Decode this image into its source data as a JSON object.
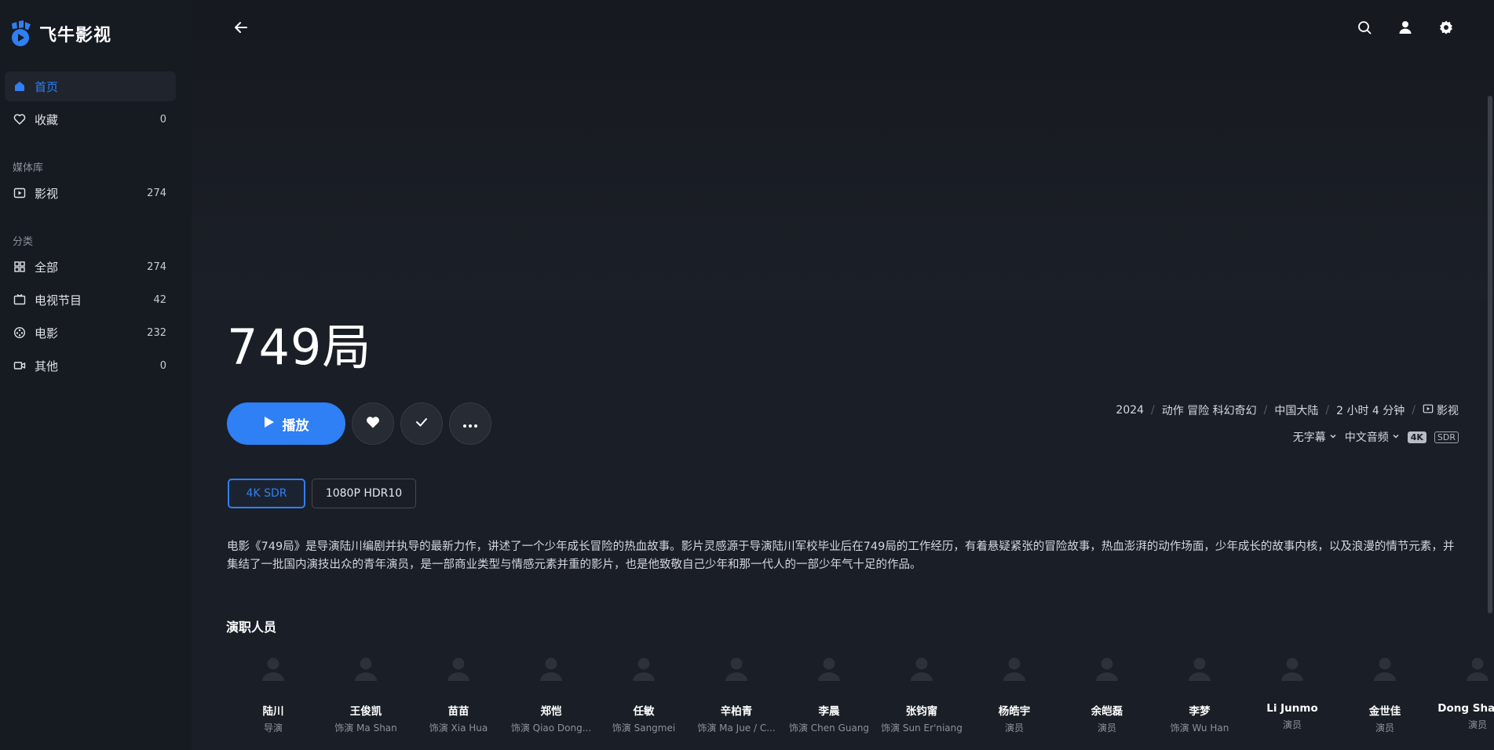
{
  "app": {
    "name": "飞牛影视",
    "brand_color": "#2f7ff5"
  },
  "sidebar": {
    "top_items": [
      {
        "label": "首页",
        "count": "",
        "icon": "home-icon",
        "active": true
      },
      {
        "label": "收藏",
        "count": "0",
        "icon": "heart-outline-icon",
        "active": false
      }
    ],
    "library_section": "媒体库",
    "library_items": [
      {
        "label": "影视",
        "count": "274",
        "icon": "media-library-icon"
      }
    ],
    "category_section": "分类",
    "category_items": [
      {
        "label": "全部",
        "count": "274",
        "icon": "grid-icon"
      },
      {
        "label": "电视节目",
        "count": "42",
        "icon": "tv-icon"
      },
      {
        "label": "电影",
        "count": "232",
        "icon": "film-reel-icon"
      },
      {
        "label": "其他",
        "count": "0",
        "icon": "video-camera-icon"
      }
    ]
  },
  "header": {
    "icons": [
      "back-arrow-icon",
      "search-icon",
      "user-icon",
      "settings-icon"
    ]
  },
  "movie": {
    "title": "749局",
    "play_label": "播放",
    "meta": {
      "year": "2024",
      "genres": "动作 冒险 科幻奇幻",
      "region": "中国大陆",
      "duration": "2 小时 4 分钟",
      "library": "影视"
    },
    "subtitle_select": "无字幕",
    "audio_select": "中文音频",
    "badges": {
      "resolution": "4K",
      "dynamic_range": "SDR"
    },
    "versions": [
      {
        "label": "4K SDR",
        "selected": true
      },
      {
        "label": "1080P HDR10",
        "selected": false
      }
    ],
    "description": "电影《749局》是导演陆川编剧并执导的最新力作，讲述了一个少年成长冒险的热血故事。影片灵感源于导演陆川军校毕业后在749局的工作经历，有着悬疑紧张的冒险故事，热血澎湃的动作场面，少年成长的故事内核，以及浪漫的情节元素，并集结了一批国内演技出众的青年演员，是一部商业类型与情感元素并重的影片，也是他致敬自己少年和那一代人的一部少年气十足的作品。"
  },
  "cast_section": {
    "title": "演职人员",
    "members": [
      {
        "name": "陆川",
        "role": "导演"
      },
      {
        "name": "王俊凯",
        "role": "饰演 Ma Shan"
      },
      {
        "name": "苗苗",
        "role": "饰演 Xia Hua"
      },
      {
        "name": "郑恺",
        "role": "饰演 Qiao Dong..."
      },
      {
        "name": "任敏",
        "role": "饰演 Sangmei"
      },
      {
        "name": "辛柏青",
        "role": "饰演 Ma Jue / C..."
      },
      {
        "name": "李晨",
        "role": "饰演 Chen Guang"
      },
      {
        "name": "张钧甯",
        "role": "饰演 Sun Er'niang"
      },
      {
        "name": "杨皓宇",
        "role": "演员"
      },
      {
        "name": "余皑磊",
        "role": "演员"
      },
      {
        "name": "李梦",
        "role": "饰演 Wu Han"
      },
      {
        "name": "Li Junmo",
        "role": "演员"
      },
      {
        "name": "金世佳",
        "role": "演员"
      },
      {
        "name": "Dong Shaohu",
        "role": "演员"
      }
    ]
  }
}
